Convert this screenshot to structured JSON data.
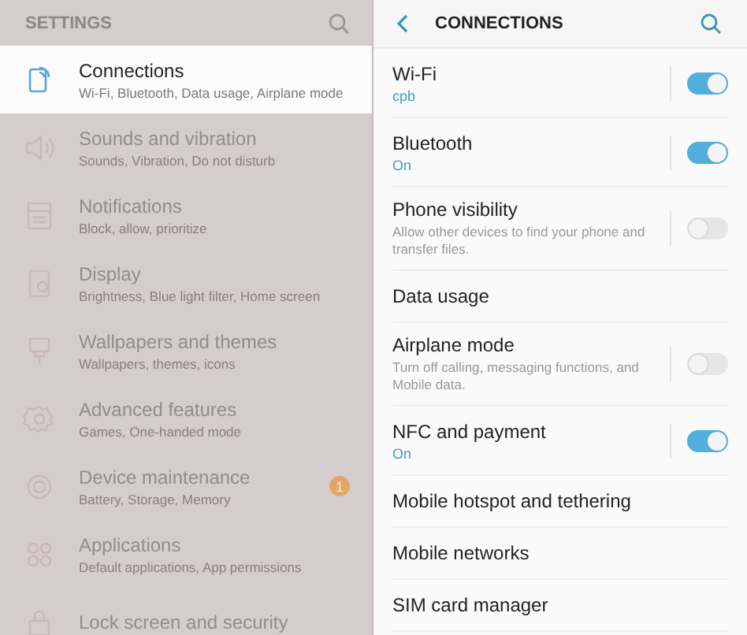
{
  "settings": {
    "title": "SETTINGS",
    "items": [
      {
        "title": "Connections",
        "subtitle": "Wi-Fi, Bluetooth, Data usage, Airplane mode",
        "selected": true
      },
      {
        "title": "Sounds and vibration",
        "subtitle": "Sounds, Vibration, Do not disturb",
        "selected": false
      },
      {
        "title": "Notifications",
        "subtitle": "Block, allow, prioritize",
        "selected": false
      },
      {
        "title": "Display",
        "subtitle": "Brightness, Blue light filter, Home screen",
        "selected": false
      },
      {
        "title": "Wallpapers and themes",
        "subtitle": "Wallpapers, themes, icons",
        "selected": false
      },
      {
        "title": "Advanced features",
        "subtitle": "Games, One-handed mode",
        "selected": false
      },
      {
        "title": "Device maintenance",
        "subtitle": "Battery, Storage, Memory",
        "selected": false,
        "badge": "1"
      },
      {
        "title": "Applications",
        "subtitle": "Default applications, App permissions",
        "selected": false
      },
      {
        "title": "Lock screen and security",
        "selected": false
      }
    ]
  },
  "connections": {
    "title": "CONNECTIONS",
    "items": [
      {
        "kind": "toggle",
        "title": "Wi-Fi",
        "status": "cpb",
        "on": true
      },
      {
        "kind": "toggle",
        "title": "Bluetooth",
        "status": "On",
        "on": true
      },
      {
        "kind": "toggle",
        "title": "Phone visibility",
        "description": "Allow other devices to find your phone and transfer files.",
        "on": false
      },
      {
        "kind": "link",
        "title": "Data usage"
      },
      {
        "kind": "toggle",
        "title": "Airplane mode",
        "description": "Turn off calling, messaging functions, and Mobile data.",
        "on": false
      },
      {
        "kind": "toggle",
        "title": "NFC and payment",
        "status": "On",
        "on": true
      },
      {
        "kind": "link",
        "title": "Mobile hotspot and tethering"
      },
      {
        "kind": "link",
        "title": "Mobile networks"
      },
      {
        "kind": "link",
        "title": "SIM card manager"
      }
    ]
  }
}
